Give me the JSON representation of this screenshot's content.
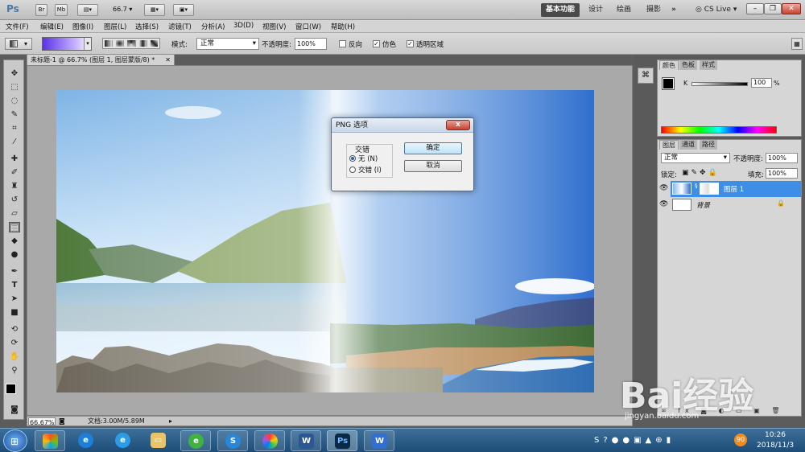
{
  "titlebar": {
    "ps_logo": "Ps",
    "br_label": "Br",
    "mb_label": "Mb",
    "zoom_value": "66.7",
    "workspaces": [
      "基本功能",
      "设计",
      "绘画",
      "摄影"
    ],
    "more": "»",
    "cs_live": "CS Live"
  },
  "menubar": {
    "items": [
      "文件(F)",
      "编辑(E)",
      "图像(I)",
      "图层(L)",
      "选择(S)",
      "滤镜(T)",
      "分析(A)",
      "3D(D)",
      "视图(V)",
      "窗口(W)",
      "帮助(H)"
    ]
  },
  "options": {
    "mode_label": "模式:",
    "mode_value": "正常",
    "opacity_label": "不透明度:",
    "opacity_value": "100%",
    "reverse_label": "反向",
    "dither_label": "仿色",
    "transparency_label": "透明区域",
    "reverse_checked": false,
    "dither_checked": true,
    "transparency_checked": true
  },
  "document": {
    "tab_title": "未标题-1 @ 66.7% (图层 1, 图层蒙版/8) *",
    "zoom_status": "66.67%",
    "doc_info": "文档:3.00M/5.89M"
  },
  "dialog": {
    "title": "PNG 选项",
    "group_label": "交错",
    "option_none": "无 (N)",
    "option_interlaced": "交错 (I)",
    "selected": "none",
    "ok_label": "确定",
    "cancel_label": "取消"
  },
  "color_panel": {
    "tabs": [
      "颜色",
      "色板",
      "样式"
    ],
    "channel_label": "K",
    "value": "100",
    "unit": "%"
  },
  "layers_panel": {
    "tabs": [
      "图层",
      "通道",
      "路径"
    ],
    "blend_mode": "正常",
    "opacity_label": "不透明度:",
    "opacity_value": "100%",
    "lock_label": "锁定:",
    "fill_label": "填充:",
    "fill_value": "100%",
    "layers": [
      {
        "name": "图层 1",
        "selected": true
      },
      {
        "name": "背景",
        "selected": false
      }
    ]
  },
  "watermark": {
    "text": "Bai经验",
    "url": "jingyan.baidu.com"
  },
  "taskbar": {
    "time": "10:26",
    "date": "2018/11/3",
    "badge": "90"
  },
  "colors": {
    "accent": "#3b82c4",
    "selected_layer": "#3d8ee6",
    "taskbar": "#1d4d78"
  }
}
